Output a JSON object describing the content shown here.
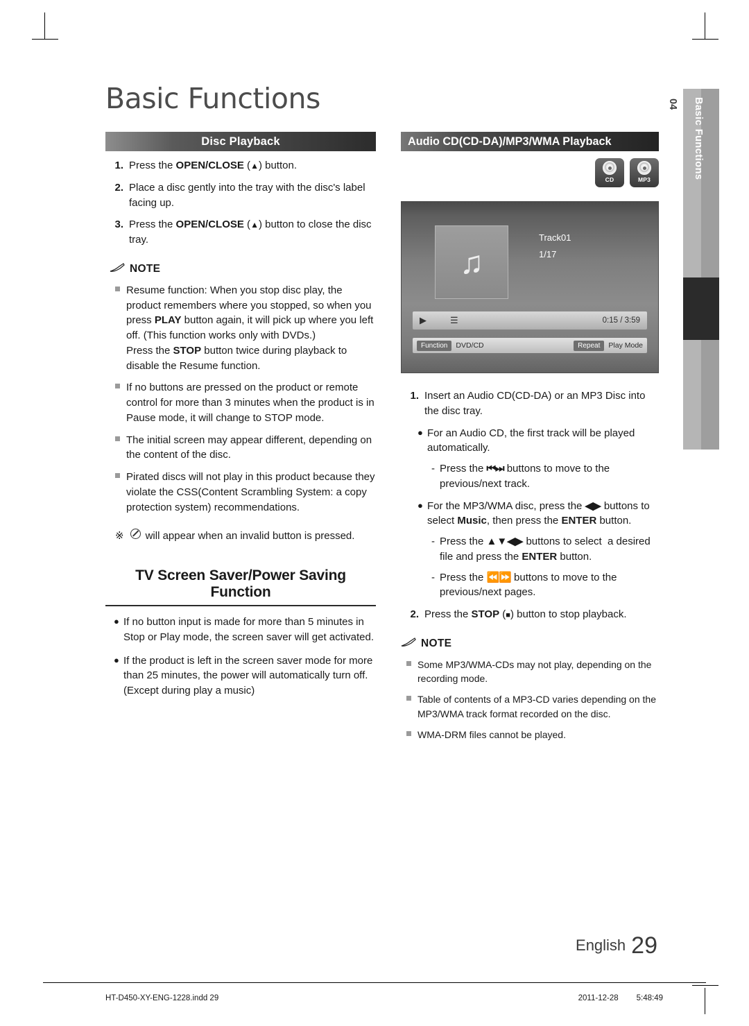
{
  "page_title": "Basic Functions",
  "side_tab": {
    "chapter_number": "04",
    "chapter_label": "Basic Functions"
  },
  "left": {
    "section_title": "Disc Playback",
    "steps": [
      {
        "num": "1.",
        "text": "Press the OPEN/CLOSE (⏏) button."
      },
      {
        "num": "2.",
        "text": "Place a disc gently into the tray with the disc's label facing up."
      },
      {
        "num": "3.",
        "text": "Press the OPEN/CLOSE (⏏) button to close the disc tray."
      }
    ],
    "note_label": "NOTE",
    "notes": [
      "Resume function: When you stop disc play, the product remembers where you stopped, so when you press PLAY button again, it will pick up where you left off. (This function works only with DVDs.) Press the STOP button twice during playback to disable the Resume function.",
      "If no buttons are pressed on the product or remote control for more than 3 minutes when the product is in Pause mode, it will change to STOP mode.",
      "The initial screen may appear different, depending on the content of the disc.",
      "Pirated discs will not play in this product because they violate the CSS(Content Scrambling System: a copy protection system) recommendations."
    ],
    "star_note": "will appear when an invalid button is pressed.",
    "second_heading": "TV Screen Saver/Power Saving Function",
    "bullets": [
      "If no button input is made for more than 5 minutes in Stop or Play mode, the screen saver will get activated.",
      "If the product is left in the screen saver mode for more than 25 minutes, the power will automatically turn off. (Except during play a music)"
    ]
  },
  "right": {
    "section_title": "Audio CD(CD-DA)/MP3/WMA Playback",
    "disc_icons": [
      {
        "name": "cd-disc-icon",
        "label": "CD"
      },
      {
        "name": "mp3-disc-icon",
        "label": "MP3"
      }
    ],
    "screenshot": {
      "track_label": "Track01",
      "track_index": "1/17",
      "time": "0:15 / 3:59",
      "function_chip": "Function",
      "source_label": "DVD/CD",
      "repeat_chip": "Repeat",
      "play_mode_label": "Play Mode"
    },
    "steps": [
      {
        "num": "1.",
        "text": "Insert an Audio CD(CD-DA) or an MP3 Disc into the disc tray."
      },
      {
        "num": "2.",
        "text": "Press the STOP (■) button to stop playback."
      }
    ],
    "sub_bullets": [
      "For an Audio CD, the first track will be played automatically.",
      "For the MP3/WMA disc, press the ◀▶ buttons to select Music, then press the ENTER button."
    ],
    "dash_items": [
      "Press the ⏮ ⏭ buttons to move to the previous/next track.",
      "Press the ▲▼◀▶ buttons to select  a desired file and press the ENTER button.",
      "Press the ⏪ ⏩ buttons to move to the previous/next pages."
    ],
    "note_label": "NOTE",
    "notes": [
      "Some MP3/WMA-CDs may not play, depending on the recording mode.",
      "Table of contents of a MP3-CD varies depending on the MP3/WMA track format recorded on the disc.",
      "WMA-DRM files cannot be played."
    ]
  },
  "footer": {
    "language": "English",
    "page_number": "29",
    "file_name": "HT-D450-XY-ENG-1228.indd   29",
    "date": "2011-12-28",
    "time": "5:48:49"
  }
}
